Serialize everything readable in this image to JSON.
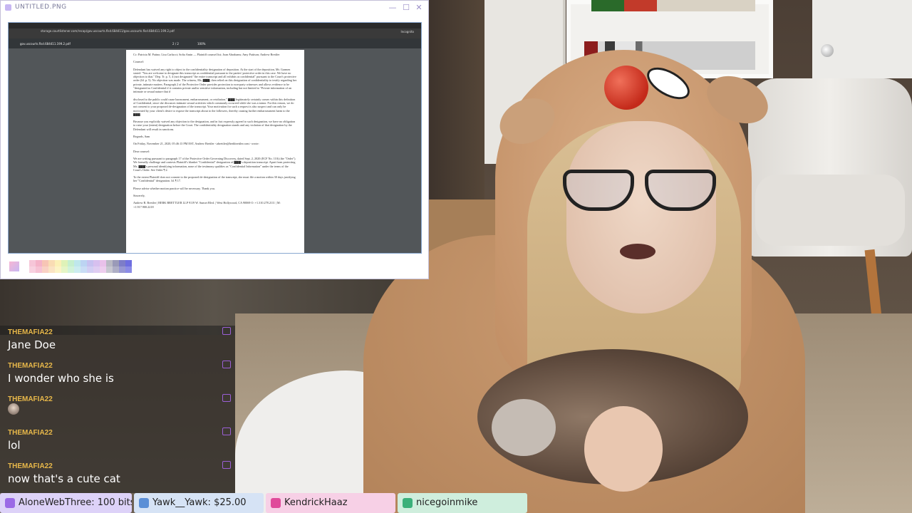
{
  "window": {
    "title": "UNTITLED.PNG",
    "minimize": "—",
    "maximize": "☐",
    "close": "✕"
  },
  "browser": {
    "url": "storage.courtlistener.com/recap/gov.uscourts.flsd.684411/gov.uscourts.flsd.684411.199.2.pdf",
    "incognito": "Incognito",
    "pdf_name": "gov.uscourts.flsd.684411.199.2.pdf",
    "page_indicator": "2 / 2",
    "zoom": "100%"
  },
  "document": {
    "paragraphs": [
      "Cc: Patricia M. Patino; Lisa Carlucci; Sofia Amin — Plaintiff counsel list; Joan Abrahams; Amy Pattison; Andrew Brettler",
      "Counsel:",
      "Defendant has waived any right to object to the confidentiality designation of deposition. At the start of the deposition, Mr. Garmen stated: \"You are welcome to designate this transcript as confidential pursuant to the parties' protective order in this case. We have no objection to that.\" Dep. Tr. p. 5, 4 (not designated \"the entire transcript and all exhibits as confidential\" pursuant to the Court's protective order (Id. p. 5). No objection was made. The witness, Ms. ▇▇▇, then relied on this designation of confidentiality to testify regarding her private, intimate matters. Paragraph 2 of the Protective Order provides protection to non-party witnesses and allows evidence to be \"designated as Confidential if it contains private and/or sensitive information, including but not limited to \"Private information of an intimate or sexual nature that if",
      "disclosed to the public could cause harassment, embarrassment, or retaliation.\" ▇▇▇ legitimately certainly comes within this definition of Confidential, since she discusses intimate sexual activities which commonly occurred while she was a minor. For this reason, we do not consent to your proposed de-designation of the transcript. Your motivation for such a request is also suspect and can only be motivated by your client's desire to expose the transcript about to the followers, thereby causing further embarrassment harm to the ▇▇▇.",
      "Because you explicitly waived any objection to the designation, and in fact expressly agreed to such designation, we have no obligation to raise your (intent) designation before the Court. The confidentiality designation stands and any violation of that designation by the Defendant will result in sanctions.",
      "Regards, Sam",
      "On Friday, November 21, 2020, 05:46:13 PM EST, Andrew Brettler <abrettler@berkbrettler.com> wrote:",
      "Dear counsel:",
      "We are writing pursuant to paragraph 17 of the Protective Order Governing Discovery, dated Sept. 2, 2020 (ECF No. 110) (the \"Order\"). We formally challenge and contests Plaintiff's blanket \"Confidential\" designation of ▇▇▇'s deposition transcript. Apart from protecting Ms. ▇▇▇'s personal identifying information, none of the testimony qualifies as \"Confidential Information\" under the terms of the Court's Order. See Order ¶ 2.",
      "To the extent Plaintiff does not consent to the proposed de-designation of the transcript, she must file a motion within 30 days justifying her \"Confidential\" designation. Id. ¶ 17.",
      "Please advise whether motion practice will be necessary. Thank you.",
      "Sincerely,",
      "Andrew B. Brettler | BERK BRETTLER LLP 9119 W. Sunset Blvd. | West Hollywood, CA 90069 O: +1.310.278.2111 | M: +1.917.900.2218"
    ]
  },
  "palette": {
    "colors": [
      "#f6c6d8",
      "#f4b3c9",
      "#f7c5b5",
      "#f9dcb4",
      "#fbf0b7",
      "#dff2b8",
      "#c6efcf",
      "#bfe7ec",
      "#bcd4f2",
      "#c7c2f0",
      "#d7c0ef",
      "#e9c1ea",
      "#b9b9c4",
      "#9a9ab8",
      "#7d7dc8",
      "#6e6ee0"
    ]
  },
  "chat": {
    "messages": [
      {
        "user": "THEMAFIA22",
        "text": "Jane Doe"
      },
      {
        "user": "THEMAFIA22",
        "text": "I wonder who she is"
      },
      {
        "user": "THEMAFIA22",
        "text": ""
      },
      {
        "user": "THEMAFIA22",
        "text": "lol"
      },
      {
        "user": "THEMAFIA22",
        "text": "now that's a cute cat"
      }
    ]
  },
  "ticker": {
    "items": [
      {
        "text": "AloneWebThree: 100 bits",
        "bg": "#ddd2f8",
        "icon": "#9b6ae6"
      },
      {
        "text": "Yawk__Yawk: $25.00",
        "bg": "#d6e3f5",
        "icon": "#5b8fd6"
      },
      {
        "text": "KendrickHaaz",
        "bg": "#f7d0e6",
        "icon": "#e04a9a"
      },
      {
        "text": "nicegoinmike",
        "bg": "#cfeedd",
        "icon": "#3bb07a"
      }
    ]
  }
}
